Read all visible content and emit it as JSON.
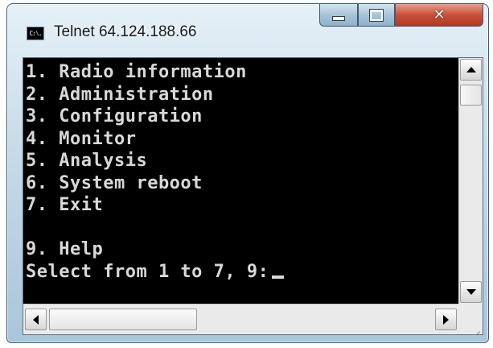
{
  "window": {
    "title": "Telnet 64.124.188.66",
    "app_icon_text": "C:\\.",
    "close_glyph": "✕"
  },
  "console": {
    "lines": [
      "1. Radio information",
      "2. Administration",
      "3. Configuration",
      "4. Monitor",
      "5. Analysis",
      "6. System reboot",
      "7. Exit",
      "",
      "9. Help"
    ],
    "prompt": "Select from 1 to 7, 9:"
  },
  "colors": {
    "console_background": "#000000",
    "console_text": "#d8d8d8",
    "close_button": "#c9503a"
  },
  "icons": {
    "app": "console-icon",
    "minimize": "minimize-icon",
    "maximize": "maximize-icon",
    "close": "close-icon",
    "scroll_up": "arrow-up-icon",
    "scroll_down": "arrow-down-icon",
    "scroll_left": "arrow-left-icon",
    "scroll_right": "arrow-right-icon"
  },
  "scrollbars": {
    "vertical_position_fraction": 0.0,
    "horizontal_position_fraction": 0.0
  }
}
